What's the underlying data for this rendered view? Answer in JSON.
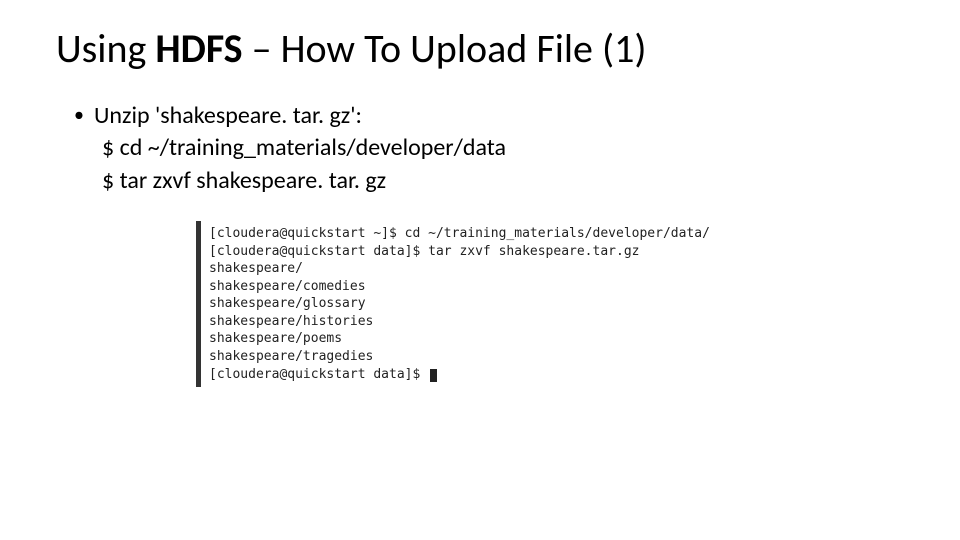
{
  "title": {
    "part1": "Using ",
    "bold": "HDFS",
    "part2": " – How To Upload File (1)"
  },
  "bullet": {
    "text": "Unzip 'shakespeare. tar. gz':"
  },
  "commands": {
    "line1": "$ cd ~/training_materials/developer/data",
    "line2": "$ tar zxvf shakespeare. tar. gz"
  },
  "terminal": {
    "l0": "[cloudera@quickstart ~]$ cd ~/training_materials/developer/data/",
    "l1": "[cloudera@quickstart data]$ tar zxvf shakespeare.tar.gz",
    "l2": "shakespeare/",
    "l3": "shakespeare/comedies",
    "l4": "shakespeare/glossary",
    "l5": "shakespeare/histories",
    "l6": "shakespeare/poems",
    "l7": "shakespeare/tragedies",
    "l8": "[cloudera@quickstart data]$ "
  }
}
